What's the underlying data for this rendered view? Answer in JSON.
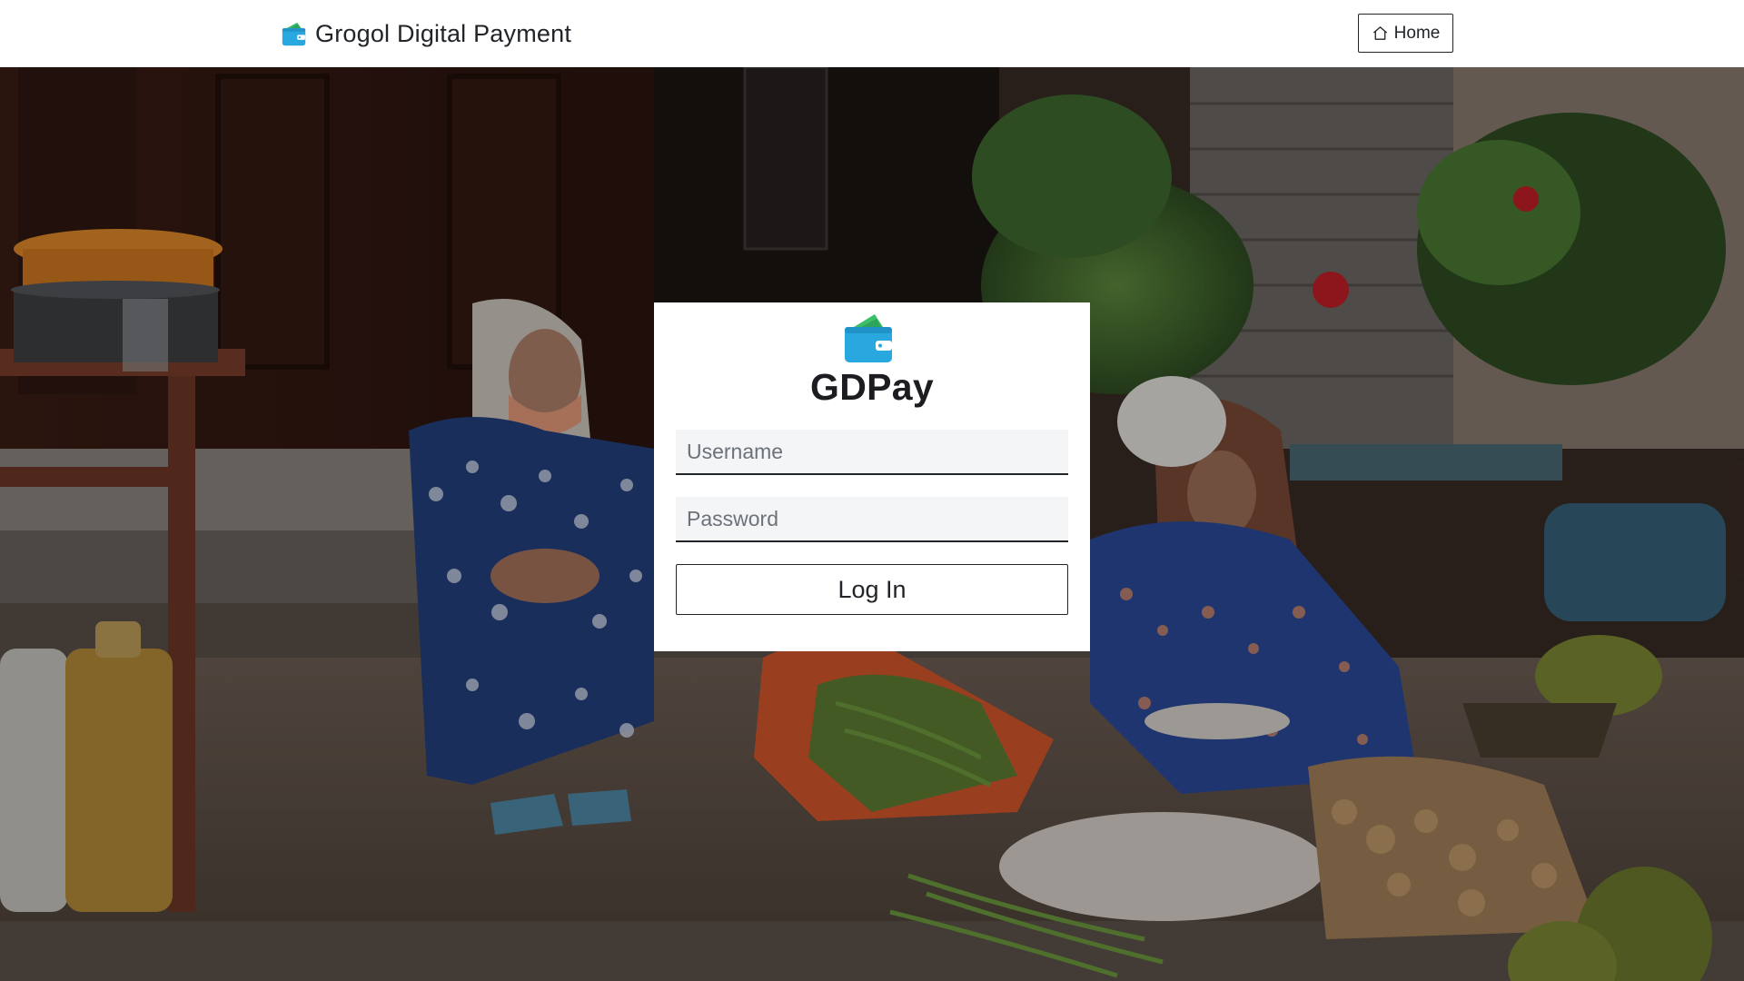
{
  "navbar": {
    "brand_text": "Grogol Digital Payment",
    "brand_icon": "wallet-icon",
    "home_label": "Home",
    "home_icon": "house-icon"
  },
  "login": {
    "logo_icon": "wallet-icon",
    "title": "GDPay",
    "username_placeholder": "Username",
    "username_value": "",
    "password_placeholder": "Password",
    "password_value": "",
    "submit_label": "Log In"
  },
  "colors": {
    "wallet_blue": "#29a8e0",
    "wallet_green": "#3cbf6b",
    "text_dark": "#212529",
    "input_bg": "#f3f5f7"
  },
  "background": {
    "description_icon": "market-photo-background"
  }
}
